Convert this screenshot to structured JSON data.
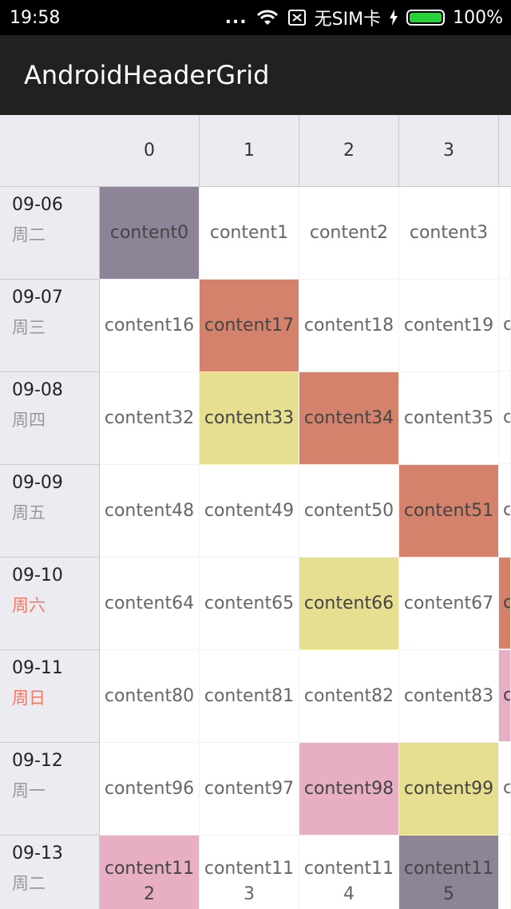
{
  "status_bar": {
    "time": "19:58",
    "dots": "...",
    "sim": "无SIM卡",
    "battery_pct": "100%",
    "icons": [
      "wifi-icon",
      "no-sim-icon",
      "charging-icon",
      "battery-icon"
    ],
    "battery_level": 1.0,
    "battery_color": "#28d03a"
  },
  "app_bar": {
    "title": "AndroidHeaderGrid"
  },
  "grid": {
    "columns": [
      "0",
      "1",
      "2",
      "3"
    ],
    "colors": {
      "gray": "#8e8497",
      "orange": "#d4826c",
      "yellow": "#e6df90",
      "pink": "#e8afc4",
      "weekend": "#f07860"
    },
    "rows": [
      {
        "date": "09-06",
        "weekday": "周二",
        "weekend": false,
        "cells": [
          {
            "text": "content0",
            "color": "gray"
          },
          {
            "text": "content1"
          },
          {
            "text": "content2"
          },
          {
            "text": "content3"
          }
        ],
        "edge": {
          "text": "",
          "color": ""
        }
      },
      {
        "date": "09-07",
        "weekday": "周三",
        "weekend": false,
        "cells": [
          {
            "text": "content16"
          },
          {
            "text": "content17",
            "color": "orange"
          },
          {
            "text": "content18"
          },
          {
            "text": "content19"
          }
        ],
        "edge": {
          "text": "c",
          "color": ""
        }
      },
      {
        "date": "09-08",
        "weekday": "周四",
        "weekend": false,
        "cells": [
          {
            "text": "content32"
          },
          {
            "text": "content33",
            "color": "yellow"
          },
          {
            "text": "content34",
            "color": "orange"
          },
          {
            "text": "content35"
          }
        ],
        "edge": {
          "text": "c",
          "color": ""
        }
      },
      {
        "date": "09-09",
        "weekday": "周五",
        "weekend": false,
        "cells": [
          {
            "text": "content48"
          },
          {
            "text": "content49"
          },
          {
            "text": "content50"
          },
          {
            "text": "content51",
            "color": "orange"
          }
        ],
        "edge": {
          "text": "c",
          "color": ""
        }
      },
      {
        "date": "09-10",
        "weekday": "周六",
        "weekend": true,
        "cells": [
          {
            "text": "content64"
          },
          {
            "text": "content65"
          },
          {
            "text": "content66",
            "color": "yellow"
          },
          {
            "text": "content67"
          }
        ],
        "edge": {
          "text": "c",
          "color": "orange"
        }
      },
      {
        "date": "09-11",
        "weekday": "周日",
        "weekend": true,
        "cells": [
          {
            "text": "content80"
          },
          {
            "text": "content81"
          },
          {
            "text": "content82"
          },
          {
            "text": "content83"
          }
        ],
        "edge": {
          "text": "c",
          "color": "pink"
        }
      },
      {
        "date": "09-12",
        "weekday": "周一",
        "weekend": false,
        "cells": [
          {
            "text": "content96"
          },
          {
            "text": "content97"
          },
          {
            "text": "content98",
            "color": "pink"
          },
          {
            "text": "content99",
            "color": "yellow"
          }
        ],
        "edge": {
          "text": "c",
          "color": ""
        }
      },
      {
        "date": "09-13",
        "weekday": "周二",
        "weekend": false,
        "cells": [
          {
            "text": "content112",
            "color": "pink"
          },
          {
            "text": "content113"
          },
          {
            "text": "content114"
          },
          {
            "text": "content115",
            "color": "gray"
          }
        ],
        "edge": {
          "text": "",
          "color": ""
        }
      }
    ]
  }
}
